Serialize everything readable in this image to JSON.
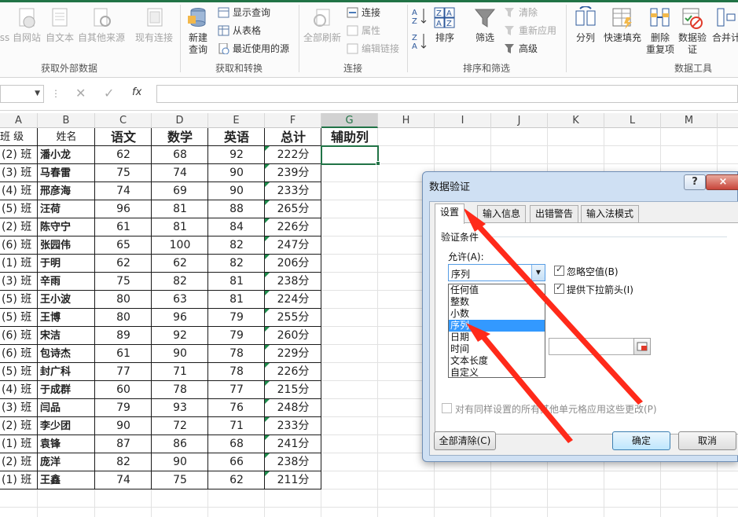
{
  "ribbon": {
    "get_external": {
      "items": [
        {
          "label": "ss",
          "icon": "web-icon"
        },
        {
          "label": "自网站",
          "icon": "globe-icon"
        },
        {
          "label": "自文本",
          "icon": "text-file-icon"
        },
        {
          "label": "自其他来源",
          "icon": "other-source-icon"
        },
        {
          "label": "现有连接",
          "icon": "existing-conn-icon"
        }
      ],
      "group_label": "获取外部数据"
    },
    "transform": {
      "new_query": "新建\n查询",
      "new_query_line1": "新建",
      "new_query_line2": "查询",
      "show_query": "显示查询",
      "from_table": "从表格",
      "recent_sources": "最近使用的源",
      "group_label": "获取和转换"
    },
    "connections": {
      "refresh_all_line1": "全部刷新",
      "connections": "连接",
      "properties": "属性",
      "edit_links": "编辑链接",
      "group_label": "连接"
    },
    "sort_filter": {
      "az": "A→Z",
      "za": "Z→A",
      "sort": "排序",
      "filter": "筛选",
      "clear": "清除",
      "reapply": "重新应用",
      "advanced": "高级",
      "group_label": "排序和筛选"
    },
    "data_tools": {
      "split": "分列",
      "flash_fill": "快速填充",
      "remove_dup_line1": "删除",
      "remove_dup_line2": "重复项",
      "validation_line1": "数据验",
      "validation_line2": "证",
      "merge": "合并计",
      "group_label": "数据工具"
    }
  },
  "formula_bar": {
    "name_value": "",
    "formula_value": "",
    "fx": "fx"
  },
  "columns": [
    "A",
    "B",
    "C",
    "D",
    "E",
    "F",
    "G",
    "H",
    "I",
    "J",
    "K",
    "L",
    "M"
  ],
  "headers": {
    "a": "班 级",
    "b": "姓名",
    "c": "语文",
    "d": "数学",
    "e": "英语",
    "f": "总计",
    "g": "辅助列"
  },
  "rows": [
    {
      "cls": "(2) 班",
      "name": "潘小龙",
      "c": "62",
      "d": "68",
      "e": "92",
      "f": "222分"
    },
    {
      "cls": "(3) 班",
      "name": "马春雷",
      "c": "75",
      "d": "74",
      "e": "90",
      "f": "239分"
    },
    {
      "cls": "(4) 班",
      "name": "邢彦海",
      "c": "74",
      "d": "69",
      "e": "90",
      "f": "233分"
    },
    {
      "cls": "(5) 班",
      "name": "汪荷",
      "c": "96",
      "d": "81",
      "e": "88",
      "f": "265分"
    },
    {
      "cls": "(2) 班",
      "name": "陈守宁",
      "c": "61",
      "d": "81",
      "e": "84",
      "f": "226分"
    },
    {
      "cls": "(6) 班",
      "name": "张园伟",
      "c": "65",
      "d": "100",
      "e": "82",
      "f": "247分"
    },
    {
      "cls": "(1) 班",
      "name": "于明",
      "c": "62",
      "d": "62",
      "e": "82",
      "f": "206分"
    },
    {
      "cls": "(3) 班",
      "name": "辛雨",
      "c": "75",
      "d": "82",
      "e": "81",
      "f": "238分"
    },
    {
      "cls": "(5) 班",
      "name": "王小波",
      "c": "80",
      "d": "63",
      "e": "81",
      "f": "224分"
    },
    {
      "cls": "(5) 班",
      "name": "王博",
      "c": "80",
      "d": "96",
      "e": "79",
      "f": "255分"
    },
    {
      "cls": "(6) 班",
      "name": "宋洁",
      "c": "89",
      "d": "92",
      "e": "79",
      "f": "260分"
    },
    {
      "cls": "(6) 班",
      "name": "包诗杰",
      "c": "61",
      "d": "90",
      "e": "78",
      "f": "229分"
    },
    {
      "cls": "(5) 班",
      "name": "封广科",
      "c": "77",
      "d": "71",
      "e": "78",
      "f": "226分"
    },
    {
      "cls": "(4) 班",
      "name": "于成群",
      "c": "60",
      "d": "78",
      "e": "77",
      "f": "215分"
    },
    {
      "cls": "(3) 班",
      "name": "闫品",
      "c": "79",
      "d": "93",
      "e": "76",
      "f": "248分"
    },
    {
      "cls": "(2) 班",
      "name": "李少团",
      "c": "90",
      "d": "72",
      "e": "71",
      "f": "233分"
    },
    {
      "cls": "(1) 班",
      "name": "袁锋",
      "c": "87",
      "d": "86",
      "e": "68",
      "f": "241分"
    },
    {
      "cls": "(2) 班",
      "name": "庞洋",
      "c": "82",
      "d": "90",
      "e": "66",
      "f": "238分"
    },
    {
      "cls": "(1) 班",
      "name": "王鑫",
      "c": "74",
      "d": "75",
      "e": "62",
      "f": "211分"
    }
  ],
  "dialog": {
    "title": "数据验证",
    "help": "?",
    "close": "×",
    "tabs": [
      "设置",
      "输入信息",
      "出错警告",
      "输入法模式"
    ],
    "section": "验证条件",
    "allow_label": "允许(A):",
    "allow_value": "序列",
    "ignore_blank": "忽略空值(B)",
    "dropdown_arrow": "提供下拉箭头(I)",
    "options": [
      "任何值",
      "整数",
      "小数",
      "序列",
      "日期",
      "时间",
      "文本长度",
      "自定义"
    ],
    "selected_option": "序列",
    "apply_all": "对有同样设置的所有其他单元格应用这些更改(P)",
    "clear_all": "全部清除(C)",
    "ok": "确定",
    "cancel": "取消"
  },
  "colors": {
    "excel_green": "#217346",
    "arrow_red": "#ff2a1a",
    "selection_blue": "#3399ff"
  }
}
